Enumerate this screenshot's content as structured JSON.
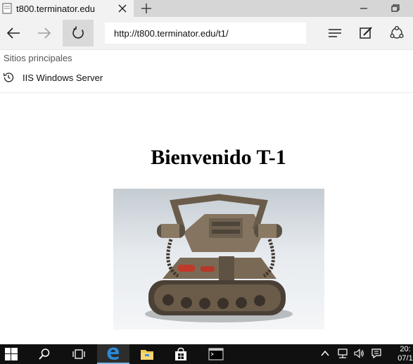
{
  "tab": {
    "title": "t800.terminator.edu"
  },
  "address_bar": {
    "url": "http://t800.terminator.edu/t1/"
  },
  "favorites": {
    "label": "Sitios principales",
    "items": [
      {
        "label": "IIS Windows Server"
      }
    ]
  },
  "page": {
    "heading": "Bienvenido T-1"
  },
  "taskbar": {
    "time": "20:",
    "date": "07/1"
  },
  "colors": {
    "tabstrip": "#d6d6d6",
    "toolbar": "#f2f2f2",
    "taskbar": "#101010",
    "edge_blue": "#1e73c8",
    "explorer_yellow": "#f2c94c"
  },
  "icons": [
    "edge-page-icon",
    "close-icon",
    "plus-icon",
    "minimize-icon",
    "restore-icon",
    "back-arrow-icon",
    "forward-arrow-icon",
    "refresh-icon",
    "hub-icon",
    "web-note-icon",
    "share-icon",
    "history-icon",
    "windows-logo-icon",
    "search-icon",
    "task-view-icon",
    "edge-icon",
    "file-explorer-icon",
    "store-icon",
    "command-prompt-icon",
    "chevron-up-icon",
    "network-icon",
    "volume-icon",
    "action-center-icon"
  ]
}
